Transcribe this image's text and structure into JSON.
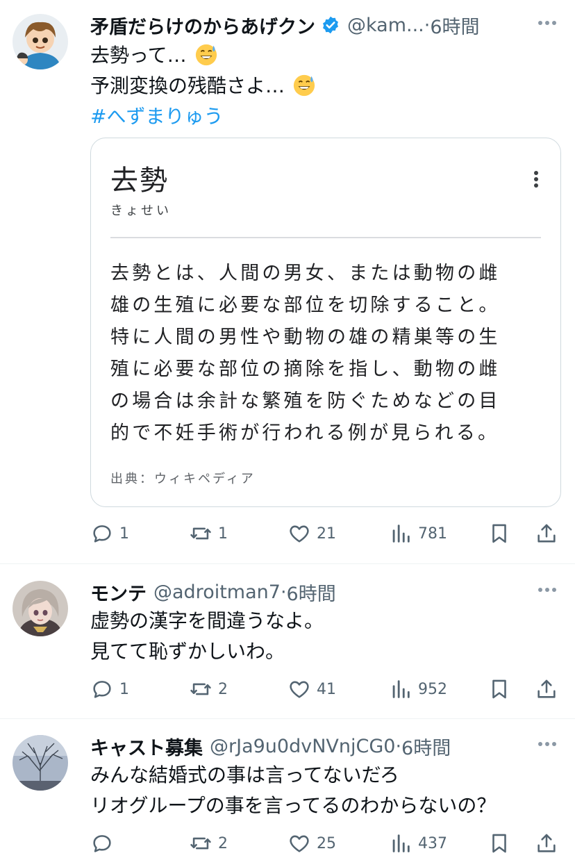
{
  "posts": [
    {
      "name": "矛盾だらけのからあげクン",
      "verified": true,
      "handle": "@kam",
      "handle_ellipsis": "...",
      "separator": "·",
      "time": "6時間",
      "lines": [
        "去勢って…",
        "予測変換の残酷さよ…",
        "#へずまりゅう"
      ],
      "line_emoji": [
        "grinning-sweat-emoji",
        "grinning-sweat-emoji",
        ""
      ],
      "card": {
        "term": "去勢",
        "reading": "きょせい",
        "definition_lines": [
          "去勢とは、人間の男女、または動物の雌",
          "雄の生殖に必要な部位を切除すること。",
          "特に人間の男性や動物の雄の精巣等の生",
          "殖に必要な部位の摘除を指し、動物の雌",
          "の場合は余計な繁殖を防ぐためなどの目",
          "的で不妊手術が行われる例が見られる。"
        ],
        "source": "出典：ウィキペディア"
      },
      "stats": {
        "replies": "1",
        "reposts": "1",
        "likes": "21",
        "views": "781"
      }
    },
    {
      "name": "モンテ",
      "verified": false,
      "handle": "@adroitman7",
      "separator": "·",
      "time": "6時間",
      "lines": [
        "虚勢の漢字を間違うなよ。",
        "見てて恥ずかしいわ。"
      ],
      "stats": {
        "replies": "1",
        "reposts": "2",
        "likes": "41",
        "views": "952"
      }
    },
    {
      "name": "キャスト募集",
      "verified": false,
      "handle": "@rJa9u0dvNVnjCG0",
      "separator": "·",
      "time": "6時間",
      "lines": [
        "みんな結婚式の事は言ってないだろ",
        "リオグループの事を言ってるのわからないの？"
      ],
      "stats": {
        "replies": "",
        "reposts": "2",
        "likes": "25",
        "views": "437"
      }
    }
  ],
  "icons": {
    "reply": "reply-icon",
    "repost": "repost-icon",
    "like": "like-icon",
    "views": "views-icon",
    "bookmark": "bookmark-icon",
    "share": "share-icon",
    "more": "more-icon",
    "verified": "verified-badge-icon"
  },
  "colors": {
    "link": "#1d9bf0",
    "secondary": "#536471",
    "verified": "#1d9bf0",
    "divider": "#eff3f4"
  }
}
